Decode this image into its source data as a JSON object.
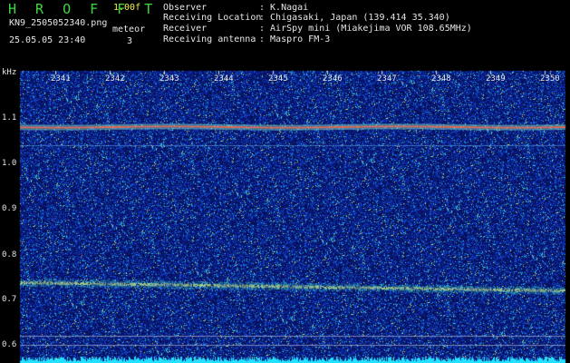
{
  "header": {
    "app_title": "H R O F F T",
    "version": "1.00f",
    "filename": "KN9_2505052340.png",
    "meteor_label": "meteor",
    "timestamp": "25.05.05 23:40",
    "meteor_count": "3"
  },
  "info": [
    {
      "label": "Observer",
      "value": ": K.Nagai"
    },
    {
      "label": "Receiving Location",
      "value": ": Chigasaki, Japan (139.414 35.340)"
    },
    {
      "label": "Receiver",
      "value": ": AirSpy mini (Miakejima VOR 108.65MHz)"
    },
    {
      "label": "Receiving antenna",
      "value": ": Maspro FM-3"
    }
  ],
  "axis": {
    "unit_label": "kHz",
    "y_ticks": [
      "1.1",
      "1.0",
      "0.9",
      "0.8",
      "0.7",
      "0.6"
    ],
    "x_ticks": [
      "2341",
      "2342",
      "2343",
      "2344",
      "2345",
      "2346",
      "2347",
      "2348",
      "2349",
      "2350"
    ]
  },
  "colors": {
    "background": "#000000",
    "noise_base": "#0d1f8a",
    "header_green": "#3ad93a",
    "header_yellow": "#f2f24a",
    "carrier": "#ff6a4d",
    "band": "#3fd0b0",
    "baseline": "#22e0ff"
  }
}
